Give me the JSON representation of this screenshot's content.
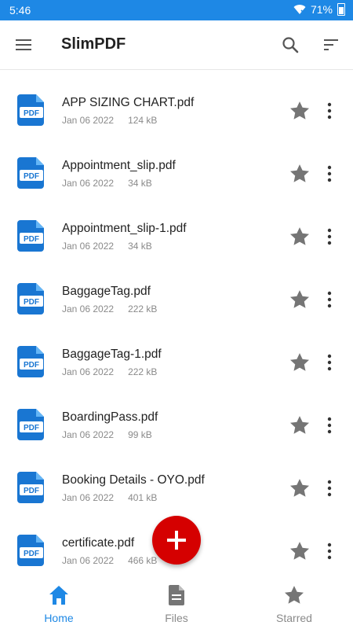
{
  "status_bar": {
    "time": "5:46",
    "battery": "71%"
  },
  "app_bar": {
    "title_prefix": "Slim",
    "title_suffix": "PDF"
  },
  "files": [
    {
      "name": "APP SIZING CHART.pdf",
      "date": "Jan 06 2022",
      "size": "124 kB",
      "icon_label": "PDF"
    },
    {
      "name": "Appointment_slip.pdf",
      "date": "Jan 06 2022",
      "size": "34 kB",
      "icon_label": "PDF"
    },
    {
      "name": "Appointment_slip-1.pdf",
      "date": "Jan 06 2022",
      "size": "34 kB",
      "icon_label": "PDF"
    },
    {
      "name": "BaggageTag.pdf",
      "date": "Jan 06 2022",
      "size": "222 kB",
      "icon_label": "PDF"
    },
    {
      "name": "BaggageTag-1.pdf",
      "date": "Jan 06 2022",
      "size": "222 kB",
      "icon_label": "PDF"
    },
    {
      "name": "BoardingPass.pdf",
      "date": "Jan 06 2022",
      "size": "99 kB",
      "icon_label": "PDF"
    },
    {
      "name": "Booking Details - OYO.pdf",
      "date": "Jan 06 2022",
      "size": "401 kB",
      "icon_label": "PDF"
    },
    {
      "name": "certificate.pdf",
      "date": "Jan 06 2022",
      "size": "466 kB",
      "icon_label": "PDF"
    }
  ],
  "bottom_nav": [
    {
      "label": "Home",
      "icon": "home-icon",
      "active": true
    },
    {
      "label": "Files",
      "icon": "file-icon",
      "active": false
    },
    {
      "label": "Starred",
      "icon": "star-icon",
      "active": false
    }
  ],
  "colors": {
    "accent": "#1e88e5",
    "fab": "#d50000",
    "star": "#757575",
    "pdf_icon": "#1976d2"
  }
}
